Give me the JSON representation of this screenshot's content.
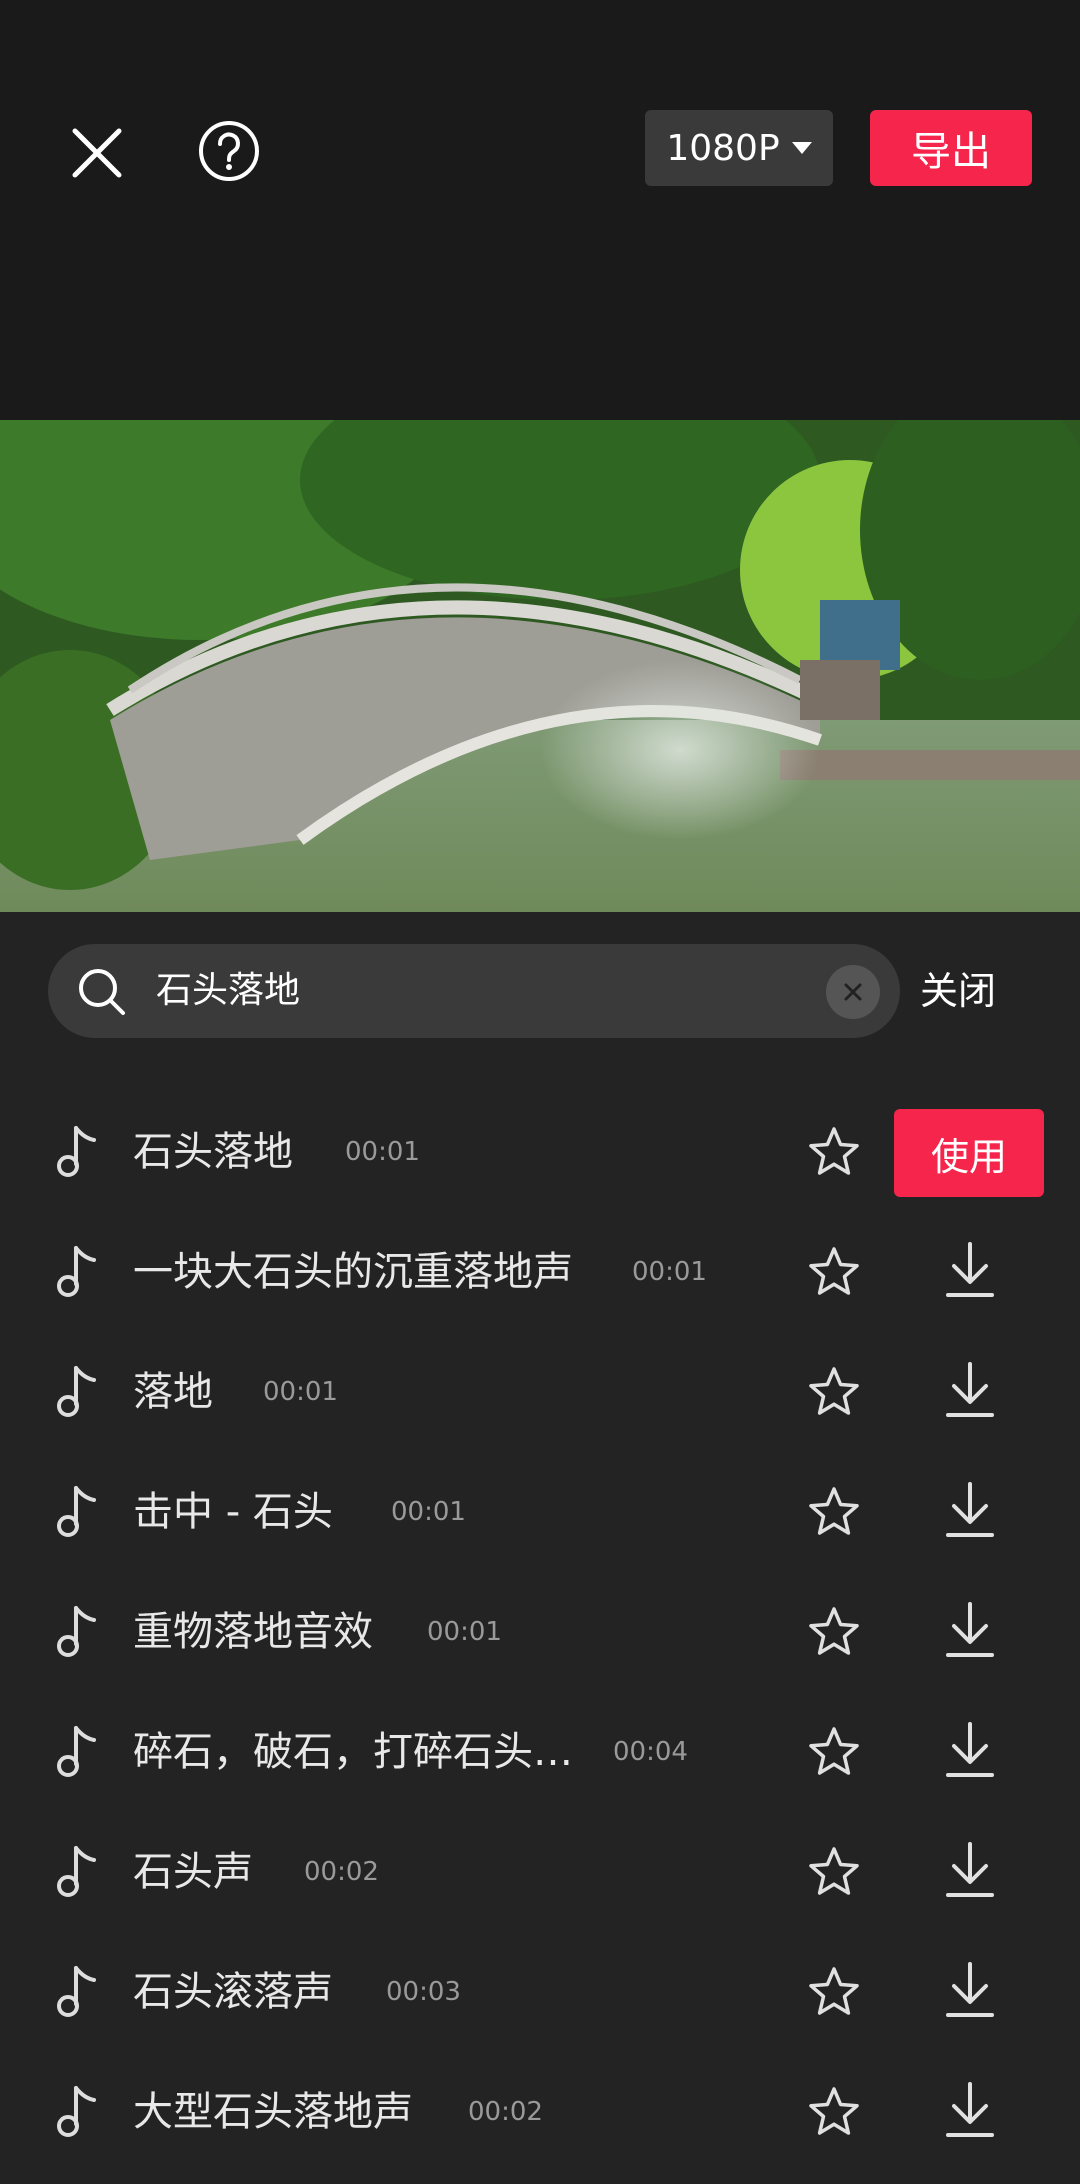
{
  "header": {
    "resolution_label": "1080P",
    "export_label": "导出"
  },
  "search": {
    "query": "石头落地",
    "close_label": "关闭"
  },
  "results": [
    {
      "title": "石头落地",
      "duration": "00:01",
      "action": "use",
      "action_label": "使用"
    },
    {
      "title": "一块大石头的沉重落地声",
      "duration": "00:01",
      "action": "download"
    },
    {
      "title": "落地",
      "duration": "00:01",
      "action": "download"
    },
    {
      "title": "击中 - 石头",
      "duration": "00:01",
      "action": "download"
    },
    {
      "title": "重物落地音效",
      "duration": "00:01",
      "action": "download"
    },
    {
      "title": "碎石，破石，打碎石头…",
      "duration": "00:04",
      "action": "download"
    },
    {
      "title": "石头声",
      "duration": "00:02",
      "action": "download"
    },
    {
      "title": "石头滚落声",
      "duration": "00:03",
      "action": "download"
    },
    {
      "title": "大型石头落地声",
      "duration": "00:02",
      "action": "download"
    }
  ],
  "colors": {
    "accent": "#f5254c",
    "background": "#1a1a1a",
    "panel": "#232323"
  },
  "icons": {
    "close": "close-icon",
    "help": "help-icon",
    "search": "search-icon",
    "clear": "clear-icon",
    "note": "music-note-icon",
    "star": "star-icon",
    "download": "download-icon"
  }
}
